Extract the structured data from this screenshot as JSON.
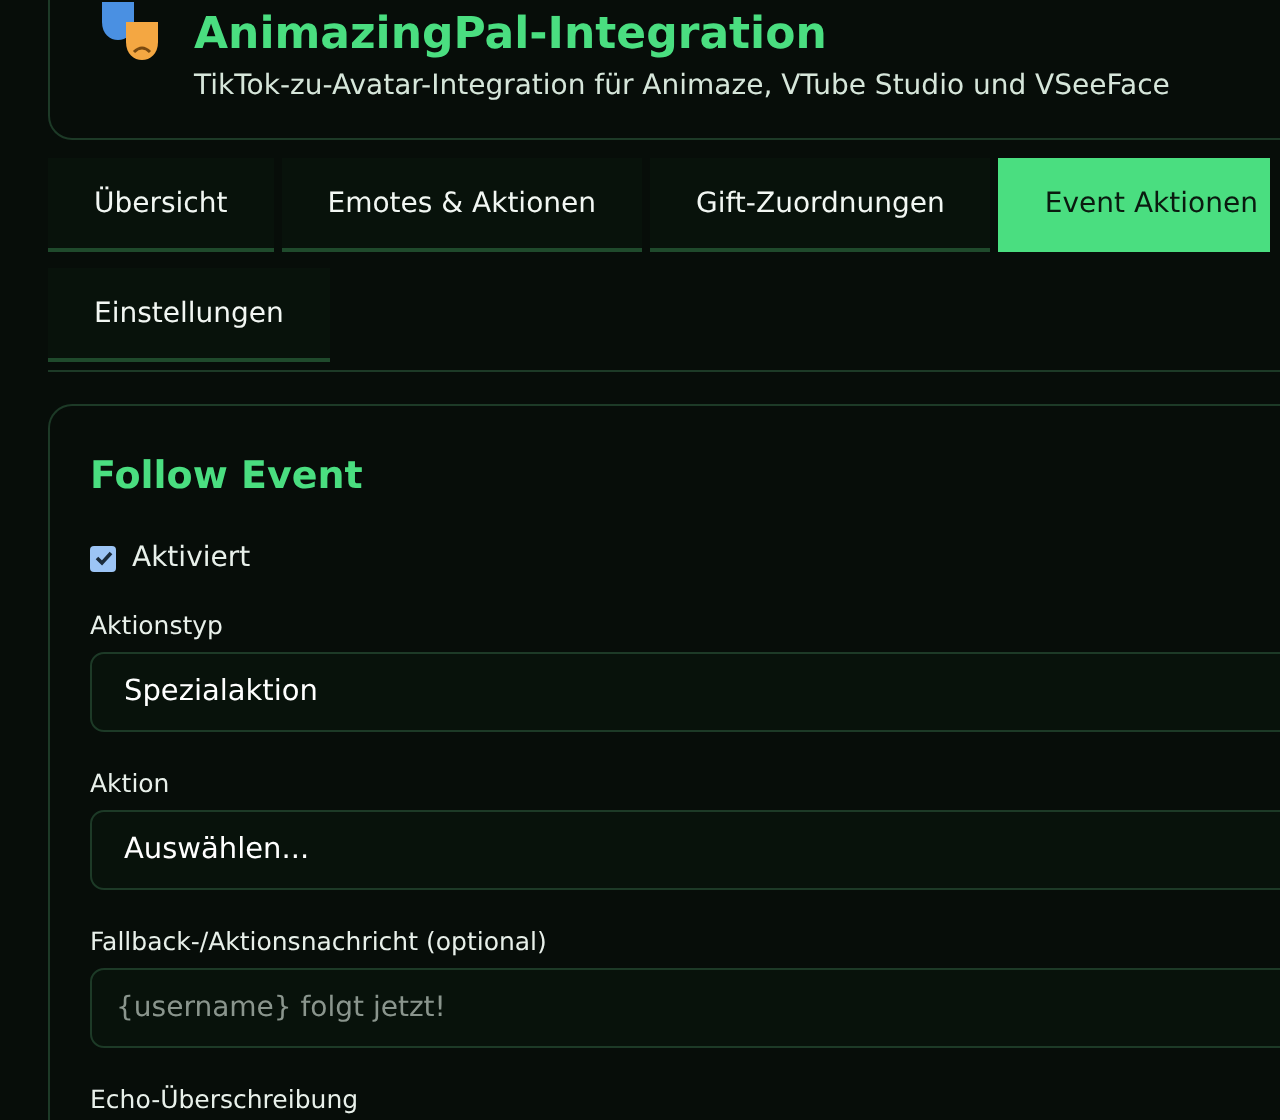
{
  "header": {
    "title": "AnimazingPal-Integration",
    "subtitle": "TikTok-zu-Avatar-Integration für Animaze, VTube Studio und VSeeFace"
  },
  "tabs": [
    {
      "label": "Übersicht",
      "selected": false
    },
    {
      "label": "Emotes & Aktionen",
      "selected": false
    },
    {
      "label": "Gift-Zuordnungen",
      "selected": false
    },
    {
      "label": "Event Aktionen",
      "selected": true
    },
    {
      "label": "Einstellungen",
      "selected": false
    }
  ],
  "event": {
    "title": "Follow Event",
    "enabled": {
      "label": "Aktiviert",
      "checked": true
    },
    "fields": [
      {
        "kind": "select",
        "label": "Aktionstyp",
        "value": "Spezialaktion"
      },
      {
        "kind": "select",
        "label": "Aktion",
        "value": "Auswählen..."
      },
      {
        "kind": "text",
        "label": "Fallback-/Aktionsnachricht (optional)",
        "placeholder": "{username} folgt jetzt!"
      },
      {
        "kind": "label",
        "label": "Echo-Überschreibung"
      }
    ]
  }
}
